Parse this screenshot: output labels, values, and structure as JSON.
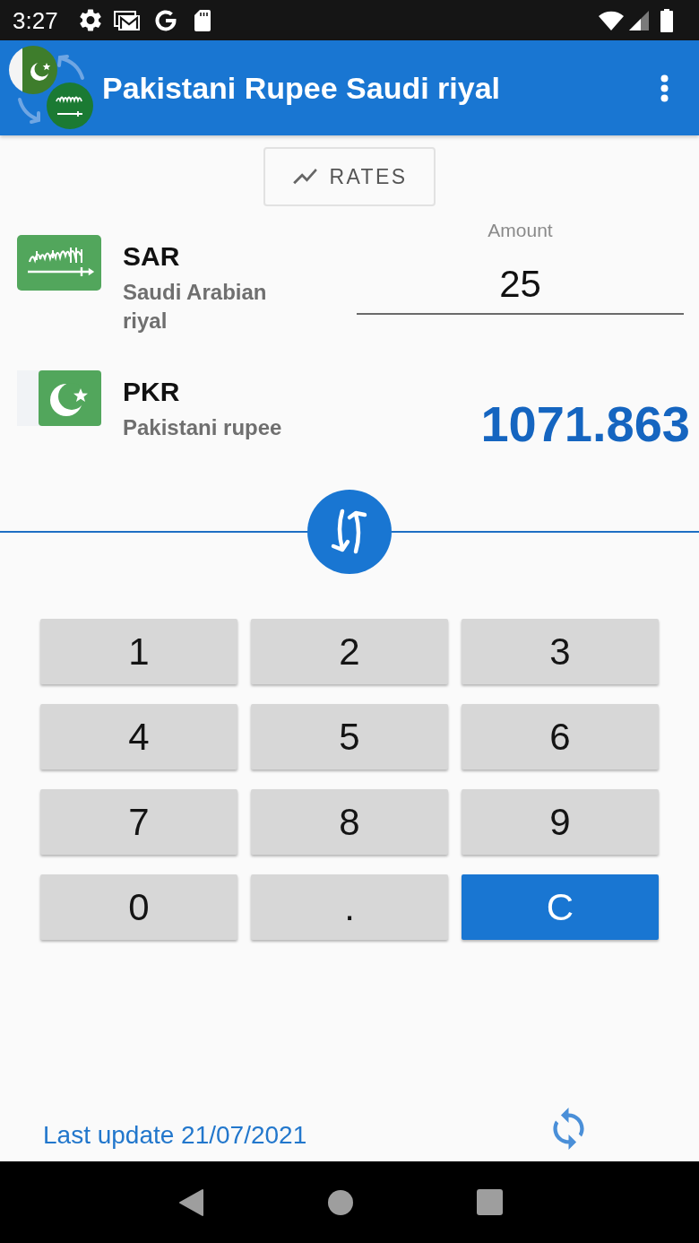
{
  "status_bar": {
    "time": "3:27"
  },
  "app_bar": {
    "title": "Pakistani Rupee Saudi riyal"
  },
  "rates_button": {
    "label": "RATES"
  },
  "currencies": [
    {
      "kind": "source",
      "code": "SAR",
      "name": "Saudi Arabian riyal",
      "amount_label": "Amount",
      "amount": "25"
    },
    {
      "kind": "target",
      "code": "PKR",
      "name": "Pakistani rupee",
      "result": "1071.863"
    }
  ],
  "keypad": [
    {
      "label": "1",
      "kind": "digit"
    },
    {
      "label": "2",
      "kind": "digit"
    },
    {
      "label": "3",
      "kind": "digit"
    },
    {
      "label": "4",
      "kind": "digit"
    },
    {
      "label": "5",
      "kind": "digit"
    },
    {
      "label": "6",
      "kind": "digit"
    },
    {
      "label": "7",
      "kind": "digit"
    },
    {
      "label": "8",
      "kind": "digit"
    },
    {
      "label": "9",
      "kind": "digit"
    },
    {
      "label": "0",
      "kind": "digit"
    },
    {
      "label": ".",
      "kind": "digit"
    },
    {
      "label": "C",
      "kind": "clear"
    }
  ],
  "footer": {
    "last_update": "Last update 21/07/2021"
  }
}
